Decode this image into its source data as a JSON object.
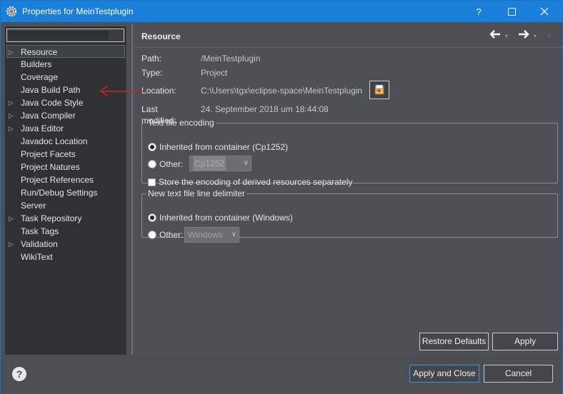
{
  "window": {
    "title": "Properties for MeinTestplugin",
    "controls": {
      "help": "?",
      "maximize": "☐",
      "close": "✕"
    }
  },
  "sidebar": {
    "filter_value": "",
    "items": [
      {
        "label": "Resource",
        "expandable": true,
        "selected": true
      },
      {
        "label": "Builders",
        "expandable": false
      },
      {
        "label": "Coverage",
        "expandable": false
      },
      {
        "label": "Java Build Path",
        "expandable": false
      },
      {
        "label": "Java Code Style",
        "expandable": true
      },
      {
        "label": "Java Compiler",
        "expandable": true
      },
      {
        "label": "Java Editor",
        "expandable": true
      },
      {
        "label": "Javadoc Location",
        "expandable": false
      },
      {
        "label": "Project Facets",
        "expandable": false
      },
      {
        "label": "Project Natures",
        "expandable": false
      },
      {
        "label": "Project References",
        "expandable": false
      },
      {
        "label": "Run/Debug Settings",
        "expandable": false
      },
      {
        "label": "Server",
        "expandable": false
      },
      {
        "label": "Task Repository",
        "expandable": true
      },
      {
        "label": "Task Tags",
        "expandable": false
      },
      {
        "label": "Validation",
        "expandable": true
      },
      {
        "label": "WikiText",
        "expandable": false
      }
    ]
  },
  "page": {
    "title": "Resource",
    "nav": {
      "back": "🡐",
      "forward": "🡒",
      "dropdown": "▾",
      "menu": "▼"
    },
    "path_label": "Path:",
    "path_value": "/MeinTestplugin",
    "type_label": "Type:",
    "type_value": "Project",
    "location_label": "Location:",
    "location_value": "C:\\Users\\tgx\\eclipse-space\\MeinTestplugin",
    "modified_label": "Last modified:",
    "modified_value": "24. September 2018 um 18:44:08",
    "encoding": {
      "legend": "Text file encoding",
      "inherited_label": "Inherited from container (Cp1252)",
      "other_label": "Other:",
      "other_value": "Cp1252",
      "store_label": "Store the encoding of derived resources separately"
    },
    "delimiter": {
      "legend": "New text file line delimiter",
      "inherited_label": "Inherited from container (Windows)",
      "other_label": "Other:",
      "other_value": "Windows"
    },
    "restore_defaults": "Restore Defaults",
    "apply": "Apply"
  },
  "footer": {
    "help": "?",
    "apply_close": "Apply and Close",
    "cancel": "Cancel"
  },
  "colors": {
    "titlebar": "#1a7fd6",
    "annotation_arrow": "#cc2222"
  }
}
